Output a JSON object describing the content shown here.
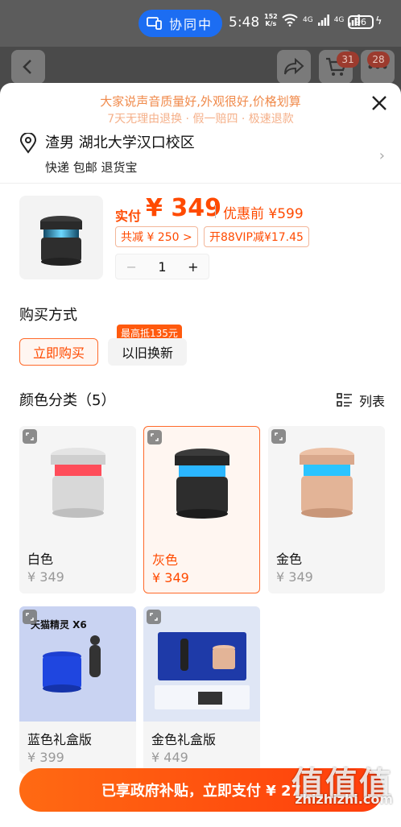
{
  "status": {
    "collab_label": "协同中",
    "time": "5:48",
    "net_speed": "152",
    "net_unit": "K/s",
    "sig1": "4G",
    "sig2": "4G",
    "battery": "96"
  },
  "nav": {
    "cart_badge": "31",
    "more_badge": "28"
  },
  "promo": {
    "line1": "大家说声音质量好,外观很好,价格划算",
    "line2": "7天无理由退换 · 假一赔四 · 极速退款"
  },
  "address": {
    "name": "渣男 湖北大学汉口校区",
    "shipping": "快递 包邮 退货宝"
  },
  "price": {
    "pay_label": "实付",
    "pay_value": "¥ 349",
    "orig": "优惠前 ¥599",
    "discount": "共减 ¥ 250 >",
    "vip": "开88VIP减¥17.45",
    "qty": "1",
    "minus": "−",
    "plus": "+"
  },
  "buy_method": {
    "title": "购买方式",
    "options": [
      "立即购买",
      "以旧换新"
    ],
    "trade_in_tag": "最高抵135元"
  },
  "colors": {
    "title": "颜色分类（5）",
    "list_label": "列表",
    "items": [
      {
        "name": "白色",
        "price": "¥ 349"
      },
      {
        "name": "灰色",
        "price": "¥ 349"
      },
      {
        "name": "金色",
        "price": "¥ 349"
      },
      {
        "name": "蓝色礼盒版",
        "price": "¥ 399",
        "box_text": "天猫精灵 X6"
      },
      {
        "name": "金色礼盒版",
        "price": "¥ 449"
      }
    ]
  },
  "buy_button": "已享政府补贴，立即支付 ¥ 27",
  "watermark": {
    "text": "值值值",
    "url": "zhizhizhi.com"
  },
  "accent": "#ff4a00"
}
